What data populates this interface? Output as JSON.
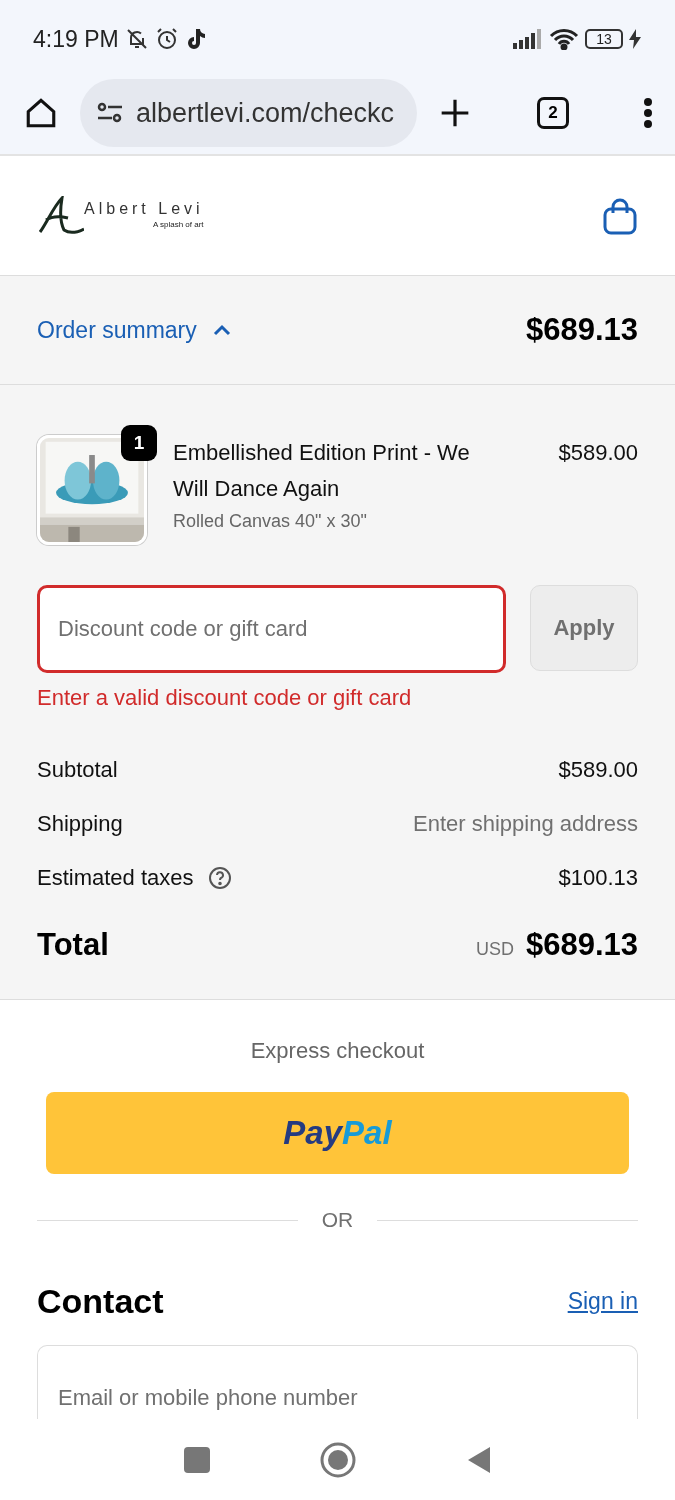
{
  "status_bar": {
    "time": "4:19 PM",
    "battery": "13"
  },
  "browser": {
    "url": "albertlevi.com/checkc",
    "tab_count": "2"
  },
  "header": {
    "brand": "Albert Levi",
    "tagline": "A splash of art"
  },
  "order_summary": {
    "label": "Order summary",
    "expanded": true,
    "total": "$689.13"
  },
  "items": [
    {
      "quantity": "1",
      "title": "Embellished Edition Print - We Will Dance Again",
      "variant": "Rolled Canvas 40\" x 30\"",
      "price": "$589.00"
    }
  ],
  "discount": {
    "placeholder": "Discount code or gift card",
    "error": "Enter a valid discount code or gift card",
    "invalid": true,
    "button": "Apply"
  },
  "lines": [
    {
      "label": "Subtotal",
      "value": "$589.00",
      "help": false,
      "muted": false
    },
    {
      "label": "Shipping",
      "value": "Enter shipping address",
      "help": false,
      "muted": true
    },
    {
      "label": "Estimated taxes",
      "value": "$100.13",
      "help": true,
      "muted": false
    }
  ],
  "total": {
    "label": "Total",
    "currency": "USD",
    "value": "$689.13"
  },
  "express": {
    "title": "Express checkout",
    "paypal": [
      "Pay",
      "Pal"
    ],
    "divider": "OR"
  },
  "contact": {
    "title": "Contact",
    "link": "Sign in",
    "placeholder": "Email or mobile phone number"
  }
}
